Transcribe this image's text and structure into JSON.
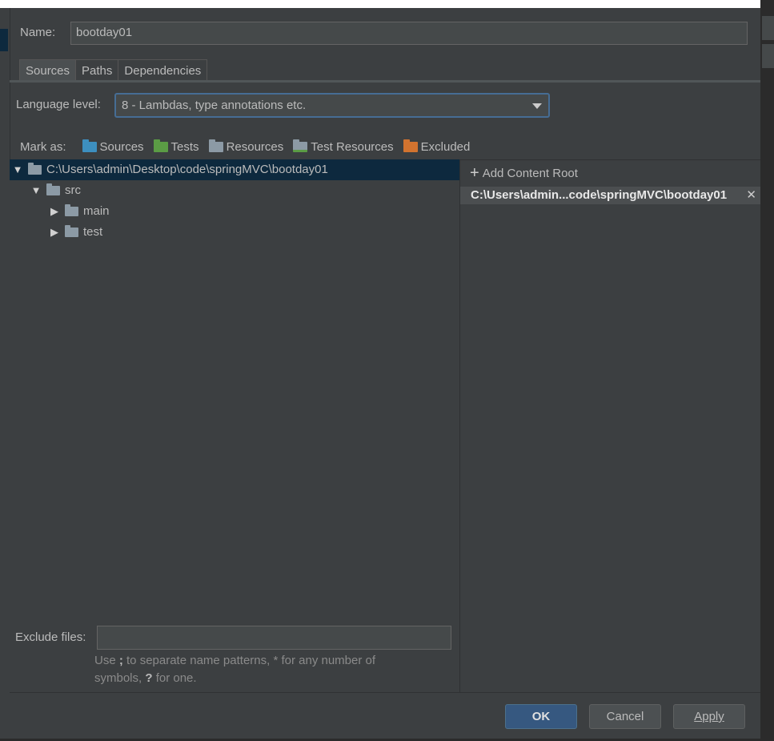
{
  "name_field": {
    "label": "Name:",
    "value": "bootday01"
  },
  "tabs": [
    {
      "label": "Sources",
      "active": true
    },
    {
      "label": "Paths",
      "active": false
    },
    {
      "label": "Dependencies",
      "active": false
    }
  ],
  "language_level": {
    "label": "Language level:",
    "value": "8 - Lambdas, type annotations etc."
  },
  "mark_as": {
    "label": "Mark as:",
    "items": [
      {
        "label": "Sources",
        "icon": "sources-folder-icon",
        "color": "#3d8fbf"
      },
      {
        "label": "Tests",
        "icon": "tests-folder-icon",
        "color": "#5b9c45"
      },
      {
        "label": "Resources",
        "icon": "resources-folder-icon",
        "color": "#8c9aa5"
      },
      {
        "label": "Test Resources",
        "icon": "test-resources-folder-icon",
        "color": "#8c9aa5"
      },
      {
        "label": "Excluded",
        "icon": "excluded-folder-icon",
        "color": "#d2732f"
      }
    ]
  },
  "tree": {
    "root": "C:\\Users\\admin\\Desktop\\code\\springMVC\\bootday01",
    "children": [
      {
        "label": "src"
      },
      {
        "label": "main"
      },
      {
        "label": "test"
      }
    ]
  },
  "content_roots": {
    "add_label": "Add Content Root",
    "path": "C:\\Users\\admin...code\\springMVC\\bootday01"
  },
  "exclude_files": {
    "label": "Exclude files:",
    "value": "",
    "hint_1": "Use ",
    "hint_sep": ";",
    "hint_2": " to separate name patterns, * for any number of",
    "hint_3": "symbols, ",
    "hint_q": "?",
    "hint_4": " for one."
  },
  "buttons": {
    "ok": "OK",
    "cancel": "Cancel",
    "apply": "Apply"
  },
  "colors": {
    "selection": "#0d293e",
    "primary_button": "#365880",
    "focus_border": "#466d94"
  }
}
